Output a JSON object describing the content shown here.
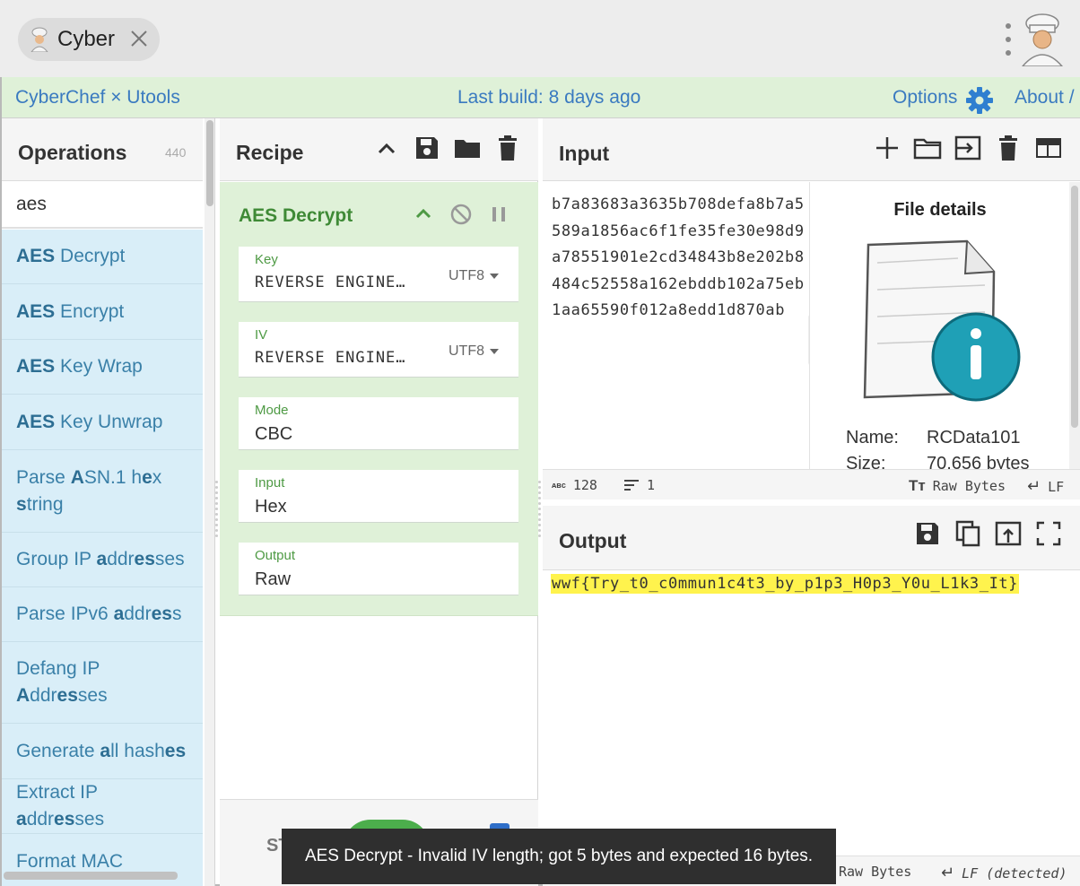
{
  "window": {
    "tab_title": "Cyber"
  },
  "nav": {
    "brand": "CyberChef × Utools",
    "build": "Last build: 8 days ago",
    "options": "Options",
    "about": "About /"
  },
  "operations": {
    "title": "Operations",
    "count": "440",
    "search_value": "aes",
    "items": [
      {
        "parts": [
          {
            "t": "AES",
            "b": true
          },
          {
            "t": " Decrypt",
            "b": false
          }
        ]
      },
      {
        "parts": [
          {
            "t": "AES",
            "b": true
          },
          {
            "t": " Encrypt",
            "b": false
          }
        ]
      },
      {
        "parts": [
          {
            "t": "AES",
            "b": true
          },
          {
            "t": " Key Wrap",
            "b": false
          }
        ]
      },
      {
        "parts": [
          {
            "t": "AES",
            "b": true
          },
          {
            "t": " Key Unwrap",
            "b": false
          }
        ]
      },
      {
        "parts": [
          {
            "t": "Parse ",
            "b": false
          },
          {
            "t": "A",
            "b": true
          },
          {
            "t": "SN.1 h",
            "b": false
          },
          {
            "t": "e",
            "b": true
          },
          {
            "t": "x ",
            "b": false
          },
          {
            "t": "s",
            "b": true
          },
          {
            "t": "tring",
            "b": false
          }
        ]
      },
      {
        "parts": [
          {
            "t": "Group IP ",
            "b": false
          },
          {
            "t": "a",
            "b": true
          },
          {
            "t": "ddr",
            "b": false
          },
          {
            "t": "es",
            "b": true
          },
          {
            "t": "ses",
            "b": false
          }
        ]
      },
      {
        "parts": [
          {
            "t": "Parse IPv6 ",
            "b": false
          },
          {
            "t": "a",
            "b": true
          },
          {
            "t": "ddr",
            "b": false
          },
          {
            "t": "es",
            "b": true
          },
          {
            "t": "s",
            "b": false
          }
        ]
      },
      {
        "parts": [
          {
            "t": "Defang IP ",
            "b": false
          },
          {
            "t": "A",
            "b": true
          },
          {
            "t": "ddr",
            "b": false
          },
          {
            "t": "es",
            "b": true
          },
          {
            "t": "ses",
            "b": false
          }
        ]
      },
      {
        "parts": [
          {
            "t": "Generate ",
            "b": false
          },
          {
            "t": "a",
            "b": true
          },
          {
            "t": "ll hash",
            "b": false
          },
          {
            "t": "es",
            "b": true
          }
        ]
      },
      {
        "parts": [
          {
            "t": "Extract IP ",
            "b": false
          },
          {
            "t": "a",
            "b": true
          },
          {
            "t": "ddr",
            "b": false
          },
          {
            "t": "es",
            "b": true
          },
          {
            "t": "ses",
            "b": false
          }
        ]
      },
      {
        "parts": [
          {
            "t": "Format MAC",
            "b": false
          }
        ]
      }
    ]
  },
  "recipe": {
    "title": "Recipe",
    "op_name": "AES Decrypt",
    "fields": {
      "key_label": "Key",
      "key_value": "REVERSE ENGINE…",
      "key_enc": "UTF8",
      "iv_label": "IV",
      "iv_value": "REVERSE ENGINE…",
      "iv_enc": "UTF8",
      "mode_label": "Mode",
      "mode_value": "CBC",
      "input_label": "Input",
      "input_value": "Hex",
      "output_label": "Output",
      "output_value": "Raw"
    },
    "step_label": "ST"
  },
  "input": {
    "title": "Input",
    "text": "b7a83683a3635b708defa8b7a5589a1856ac6f1fe35fe30e98d9a78551901e2cd34843b8e202b8484c52558a162ebddb102a75eb1aa65590f012a8edd1d870ab",
    "file_details_title": "File details",
    "name_key": "Name:",
    "name_value": "RCData101",
    "size_key": "Size:",
    "size_value": "70,656 bytes",
    "status_length": "128",
    "status_lines": "1",
    "status_encoding": "Raw Bytes",
    "status_eol": "LF"
  },
  "output": {
    "title": "Output",
    "text": "wwf{Try_t0_c0mmun1c4t3_by_p1p3_H0p3_Y0u_L1k3_It}",
    "status_encoding": "Raw Bytes",
    "status_eol": "LF (detected)"
  },
  "toast": {
    "message": "AES Decrypt - Invalid IV length; got 5 bytes and expected 16 bytes."
  },
  "colors": {
    "green_bar": "#dff1d8",
    "op_item_bg": "#d9eef8",
    "accent_blue": "#3a7ac0",
    "highlight": "#fff34d",
    "toast_bg": "#2f2f2f"
  }
}
